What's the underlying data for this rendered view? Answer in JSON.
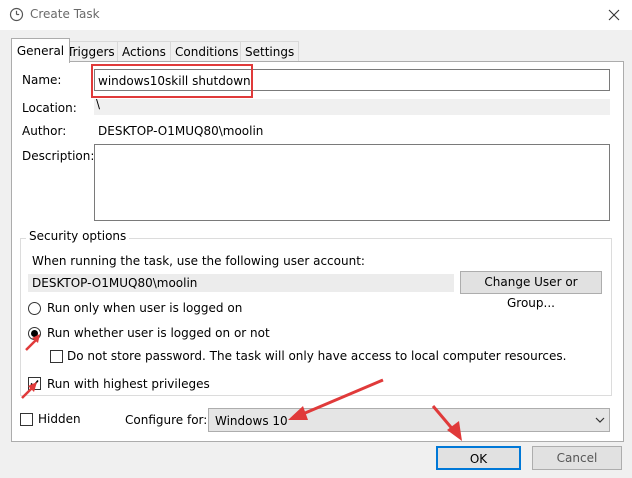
{
  "window": {
    "title": "Create Task"
  },
  "tabs": [
    {
      "label": "General",
      "active": true
    },
    {
      "label": "Triggers"
    },
    {
      "label": "Actions"
    },
    {
      "label": "Conditions"
    },
    {
      "label": "Settings"
    }
  ],
  "general": {
    "name_label": "Name:",
    "name_value": "windows10skill shutdown",
    "location_label": "Location:",
    "location_value": "\\",
    "author_label": "Author:",
    "author_value": "DESKTOP-O1MUQ80\\moolin",
    "description_label": "Description:",
    "description_value": ""
  },
  "security": {
    "group_title": "Security options",
    "account_prompt": "When running the task, use the following user account:",
    "account_value": "DESKTOP-O1MUQ80\\moolin",
    "change_button": "Change User or Group...",
    "radio_logged_on": "Run only when user is logged on",
    "radio_whether": "Run whether user is logged on or not",
    "selected_radio": "whether",
    "no_store_password": "Do not store password.  The task will only have access to local computer resources.",
    "no_store_password_checked": false,
    "highest_privileges": "Run with highest privileges",
    "highest_privileges_checked": true
  },
  "footer": {
    "hidden_label": "Hidden",
    "hidden_checked": false,
    "configure_label": "Configure for:",
    "configure_value": "Windows 10",
    "ok_button": "OK",
    "cancel_button": "Cancel"
  },
  "colors": {
    "annotation_red": "#e03a3a",
    "default_button_border": "#0078d7"
  },
  "icons": {
    "title": "task-scheduler-icon",
    "close": "close-icon",
    "dropdown": "chevron-down-icon"
  }
}
